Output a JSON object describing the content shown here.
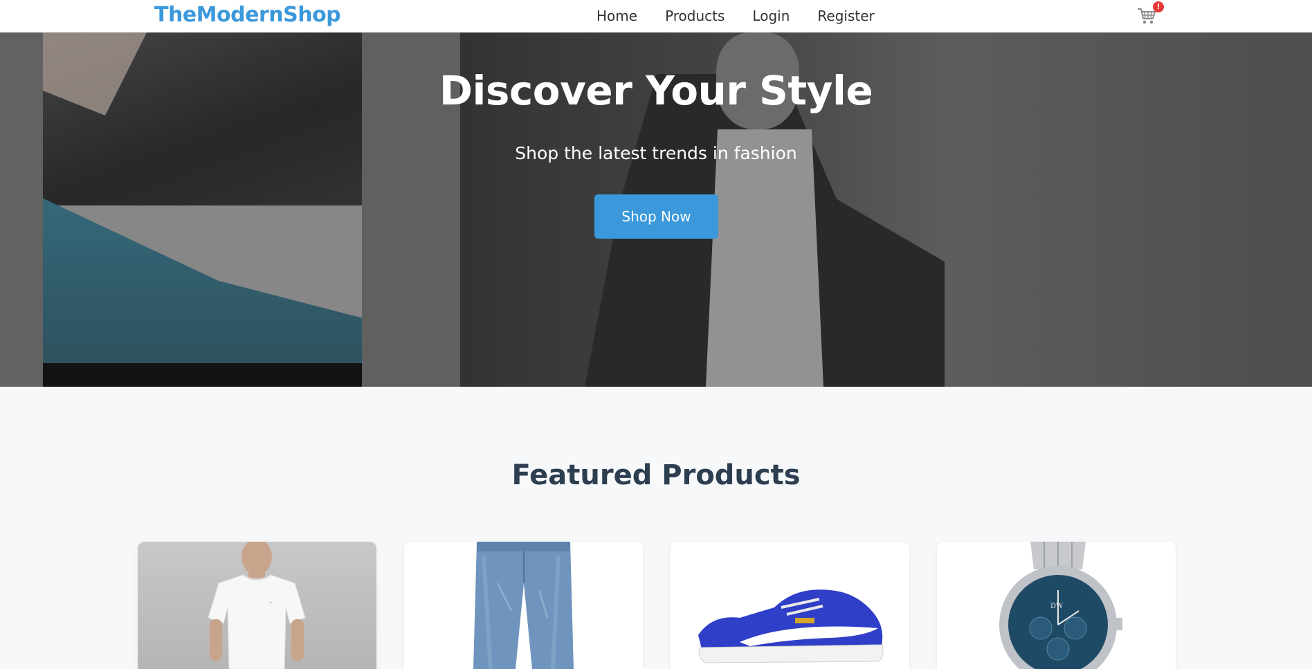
{
  "brand": {
    "name": "TheModernShop",
    "color": "#3a98db"
  },
  "nav": {
    "items": [
      {
        "label": "Home"
      },
      {
        "label": "Products"
      },
      {
        "label": "Login"
      },
      {
        "label": "Register"
      }
    ],
    "cart": {
      "icon": "shopping-cart-icon",
      "badge": "!"
    }
  },
  "hero": {
    "title": "Discover Your Style",
    "subtitle": "Shop the latest trends in fashion",
    "cta_label": "Shop Now"
  },
  "featured": {
    "title": "Featured Products",
    "products": [
      {
        "image": "t-shirt"
      },
      {
        "image": "jeans"
      },
      {
        "image": "sneaker"
      },
      {
        "image": "watch"
      }
    ]
  },
  "colors": {
    "accent": "#3a98db",
    "heading": "#2c3e50",
    "page_bg": "#f6f8fa",
    "badge": "#e53935"
  }
}
